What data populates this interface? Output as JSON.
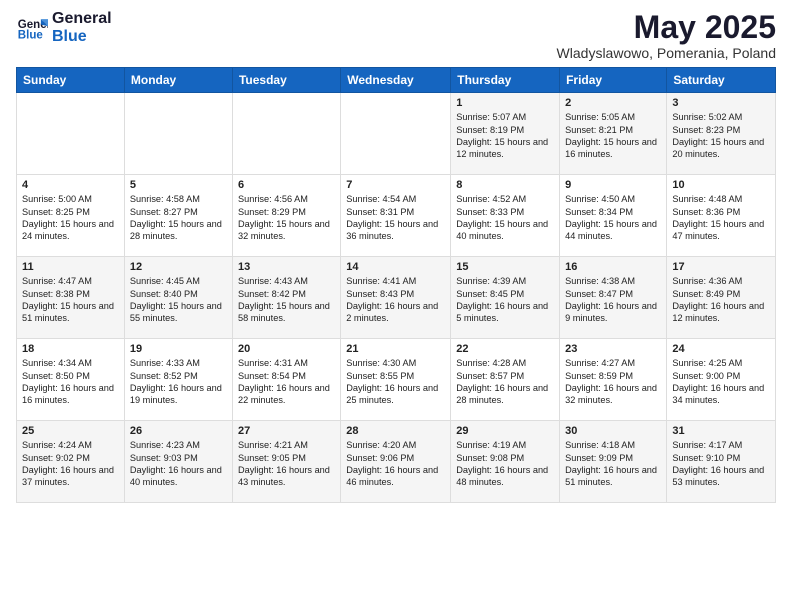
{
  "header": {
    "logo_general": "General",
    "logo_blue": "Blue",
    "month_title": "May 2025",
    "subtitle": "Wladyslawowo, Pomerania, Poland"
  },
  "days_of_week": [
    "Sunday",
    "Monday",
    "Tuesday",
    "Wednesday",
    "Thursday",
    "Friday",
    "Saturday"
  ],
  "weeks": [
    [
      {
        "day": "",
        "text": ""
      },
      {
        "day": "",
        "text": ""
      },
      {
        "day": "",
        "text": ""
      },
      {
        "day": "",
        "text": ""
      },
      {
        "day": "1",
        "text": "Sunrise: 5:07 AM\nSunset: 8:19 PM\nDaylight: 15 hours\nand 12 minutes."
      },
      {
        "day": "2",
        "text": "Sunrise: 5:05 AM\nSunset: 8:21 PM\nDaylight: 15 hours\nand 16 minutes."
      },
      {
        "day": "3",
        "text": "Sunrise: 5:02 AM\nSunset: 8:23 PM\nDaylight: 15 hours\nand 20 minutes."
      }
    ],
    [
      {
        "day": "4",
        "text": "Sunrise: 5:00 AM\nSunset: 8:25 PM\nDaylight: 15 hours\nand 24 minutes."
      },
      {
        "day": "5",
        "text": "Sunrise: 4:58 AM\nSunset: 8:27 PM\nDaylight: 15 hours\nand 28 minutes."
      },
      {
        "day": "6",
        "text": "Sunrise: 4:56 AM\nSunset: 8:29 PM\nDaylight: 15 hours\nand 32 minutes."
      },
      {
        "day": "7",
        "text": "Sunrise: 4:54 AM\nSunset: 8:31 PM\nDaylight: 15 hours\nand 36 minutes."
      },
      {
        "day": "8",
        "text": "Sunrise: 4:52 AM\nSunset: 8:33 PM\nDaylight: 15 hours\nand 40 minutes."
      },
      {
        "day": "9",
        "text": "Sunrise: 4:50 AM\nSunset: 8:34 PM\nDaylight: 15 hours\nand 44 minutes."
      },
      {
        "day": "10",
        "text": "Sunrise: 4:48 AM\nSunset: 8:36 PM\nDaylight: 15 hours\nand 47 minutes."
      }
    ],
    [
      {
        "day": "11",
        "text": "Sunrise: 4:47 AM\nSunset: 8:38 PM\nDaylight: 15 hours\nand 51 minutes."
      },
      {
        "day": "12",
        "text": "Sunrise: 4:45 AM\nSunset: 8:40 PM\nDaylight: 15 hours\nand 55 minutes."
      },
      {
        "day": "13",
        "text": "Sunrise: 4:43 AM\nSunset: 8:42 PM\nDaylight: 15 hours\nand 58 minutes."
      },
      {
        "day": "14",
        "text": "Sunrise: 4:41 AM\nSunset: 8:43 PM\nDaylight: 16 hours\nand 2 minutes."
      },
      {
        "day": "15",
        "text": "Sunrise: 4:39 AM\nSunset: 8:45 PM\nDaylight: 16 hours\nand 5 minutes."
      },
      {
        "day": "16",
        "text": "Sunrise: 4:38 AM\nSunset: 8:47 PM\nDaylight: 16 hours\nand 9 minutes."
      },
      {
        "day": "17",
        "text": "Sunrise: 4:36 AM\nSunset: 8:49 PM\nDaylight: 16 hours\nand 12 minutes."
      }
    ],
    [
      {
        "day": "18",
        "text": "Sunrise: 4:34 AM\nSunset: 8:50 PM\nDaylight: 16 hours\nand 16 minutes."
      },
      {
        "day": "19",
        "text": "Sunrise: 4:33 AM\nSunset: 8:52 PM\nDaylight: 16 hours\nand 19 minutes."
      },
      {
        "day": "20",
        "text": "Sunrise: 4:31 AM\nSunset: 8:54 PM\nDaylight: 16 hours\nand 22 minutes."
      },
      {
        "day": "21",
        "text": "Sunrise: 4:30 AM\nSunset: 8:55 PM\nDaylight: 16 hours\nand 25 minutes."
      },
      {
        "day": "22",
        "text": "Sunrise: 4:28 AM\nSunset: 8:57 PM\nDaylight: 16 hours\nand 28 minutes."
      },
      {
        "day": "23",
        "text": "Sunrise: 4:27 AM\nSunset: 8:59 PM\nDaylight: 16 hours\nand 32 minutes."
      },
      {
        "day": "24",
        "text": "Sunrise: 4:25 AM\nSunset: 9:00 PM\nDaylight: 16 hours\nand 34 minutes."
      }
    ],
    [
      {
        "day": "25",
        "text": "Sunrise: 4:24 AM\nSunset: 9:02 PM\nDaylight: 16 hours\nand 37 minutes."
      },
      {
        "day": "26",
        "text": "Sunrise: 4:23 AM\nSunset: 9:03 PM\nDaylight: 16 hours\nand 40 minutes."
      },
      {
        "day": "27",
        "text": "Sunrise: 4:21 AM\nSunset: 9:05 PM\nDaylight: 16 hours\nand 43 minutes."
      },
      {
        "day": "28",
        "text": "Sunrise: 4:20 AM\nSunset: 9:06 PM\nDaylight: 16 hours\nand 46 minutes."
      },
      {
        "day": "29",
        "text": "Sunrise: 4:19 AM\nSunset: 9:08 PM\nDaylight: 16 hours\nand 48 minutes."
      },
      {
        "day": "30",
        "text": "Sunrise: 4:18 AM\nSunset: 9:09 PM\nDaylight: 16 hours\nand 51 minutes."
      },
      {
        "day": "31",
        "text": "Sunrise: 4:17 AM\nSunset: 9:10 PM\nDaylight: 16 hours\nand 53 minutes."
      }
    ]
  ]
}
